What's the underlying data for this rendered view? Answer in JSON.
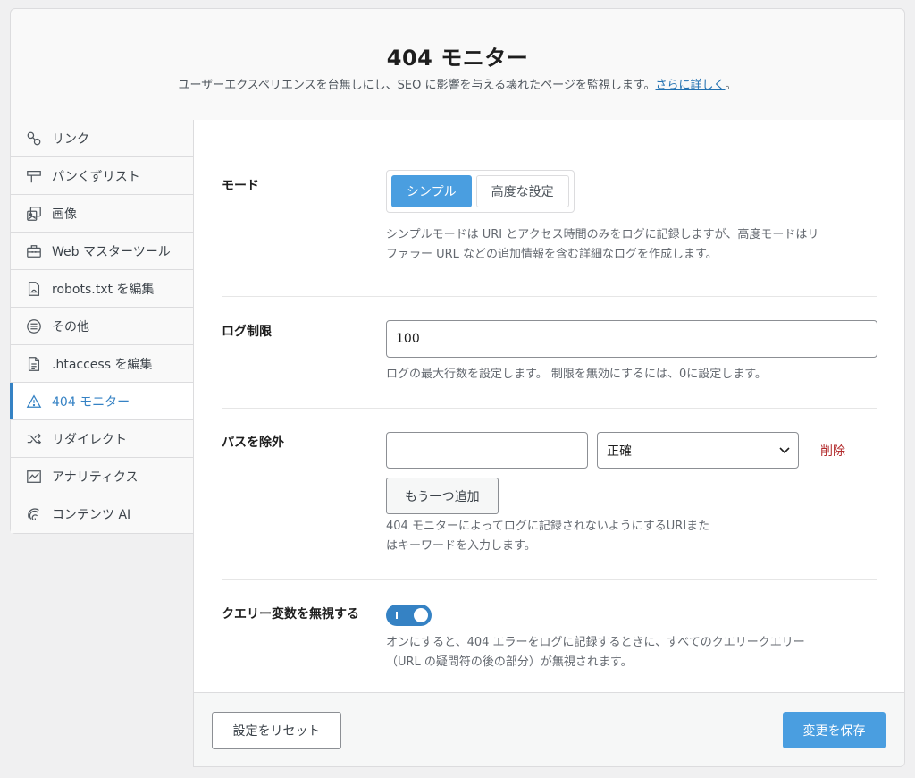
{
  "header": {
    "title": "404 モニター",
    "description": "ユーザーエクスペリエンスを台無しにし、SEO に影響を与える壊れたページを監視します。",
    "learn_more": "さらに詳しく",
    "period": "。"
  },
  "sidebar": {
    "items": [
      {
        "label": "リンク",
        "icon": "link-icon"
      },
      {
        "label": "パンくずリスト",
        "icon": "signpost-icon"
      },
      {
        "label": "画像",
        "icon": "image-icon"
      },
      {
        "label": "Web マスターツール",
        "icon": "toolbox-icon"
      },
      {
        "label": "robots.txt を編集",
        "icon": "robot-file-icon"
      },
      {
        "label": "その他",
        "icon": "list-circle-icon"
      },
      {
        "label": ".htaccess を編集",
        "icon": "file-icon"
      },
      {
        "label": "404 モニター",
        "icon": "warning-icon",
        "active": true
      },
      {
        "label": "リダイレクト",
        "icon": "shuffle-icon"
      },
      {
        "label": "アナリティクス",
        "icon": "chart-icon"
      },
      {
        "label": "コンテンツ AI",
        "icon": "fingerprint-icon"
      }
    ]
  },
  "settings": {
    "mode": {
      "label": "モード",
      "options": [
        "シンプル",
        "高度な設定"
      ],
      "selected": "シンプル",
      "help_line1": "シンプルモードは URI とアクセス時間のみをログに記録しますが、高度モードはリ",
      "help_line2": "ファラー URL などの追加情報を含む詳細なログを作成します。"
    },
    "log_limit": {
      "label": "ログ制限",
      "value": "100",
      "help": "ログの最大行数を設定します。 制限を無効にするには、0に設定します。"
    },
    "exclude_paths": {
      "label": "パスを除外",
      "path_value": "",
      "match_type": "正確",
      "delete_label": "削除",
      "add_label": "もう一つ追加",
      "help_line1": "404 モニターによってログに記録されないようにするURIまた",
      "help_line2": "はキーワードを入力します。"
    },
    "ignore_query": {
      "label": "クエリー変数を無視する",
      "enabled": true,
      "help_line1": "オンにすると、404 エラーをログに記録するときに、すべてのクエリークエリー",
      "help_line2": "（URL の疑問符の後の部分）が無視されます。"
    }
  },
  "footer": {
    "reset_label": "設定をリセット",
    "save_label": "変更を保存"
  },
  "colors": {
    "accent": "#3582c4",
    "button_primary": "#4a9ee0",
    "danger": "#b32d2e"
  }
}
